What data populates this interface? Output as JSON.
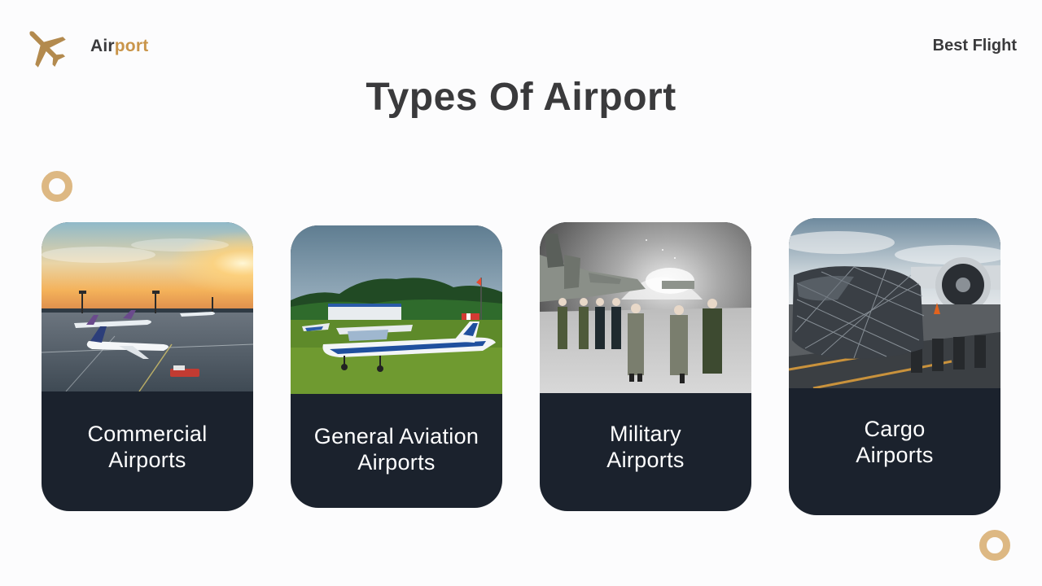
{
  "header": {
    "brand_part1": "Air",
    "brand_part2": "port",
    "tagline": "Best Flight",
    "logo_icon": "airplane-icon"
  },
  "title": "Types Of Airport",
  "colors": {
    "accent": "#c9954a",
    "ring": "#ddb883",
    "card_bg": "#1b222d",
    "text_dark": "#3a3a3c"
  },
  "cards": [
    {
      "line1": "Commercial",
      "line2": "Airports",
      "image": "commercial-airport-photo"
    },
    {
      "line1": "General Aviation",
      "line2": "Airports",
      "image": "general-aviation-photo"
    },
    {
      "line1": "Military",
      "line2": "Airports",
      "image": "military-airport-photo"
    },
    {
      "line1": "Cargo",
      "line2": "Airports",
      "image": "cargo-airport-photo"
    }
  ]
}
